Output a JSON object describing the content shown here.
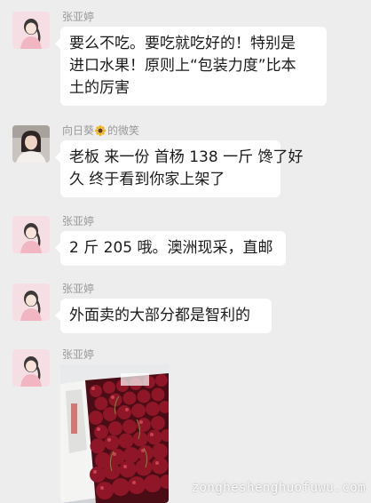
{
  "messages": [
    {
      "sender": "张亚婷",
      "avatar_icon": "girl-avatar-icon",
      "lines": [
        "要么不吃。要吃就吃好的！特别是",
        "进口水果！原则上“包装力度”比本",
        "土的厉害"
      ]
    },
    {
      "sender_prefix": "向日葵",
      "sender_emoji": "sunflower-icon",
      "sender_suffix": "的微笑",
      "avatar_icon": "woman-photo-avatar-icon",
      "lines": [
        "老板 来一份 首杨 138 一斤 馋了好",
        "久 终于看到你家上架了"
      ]
    },
    {
      "sender": "张亚婷",
      "avatar_icon": "girl-avatar-icon",
      "lines": [
        "2 斤 205 哦。澳洲现采，直邮"
      ]
    },
    {
      "sender": "张亚婷",
      "avatar_icon": "girl-avatar-icon",
      "lines": [
        "外面卖的大部分都是智利的"
      ]
    },
    {
      "sender": "张亚婷",
      "avatar_icon": "girl-avatar-icon",
      "image": "cherry-box-photo"
    }
  ],
  "watermark": "zongheshenghuofuwu.com",
  "colors": {
    "background": "#ededed",
    "bubble": "#ffffff",
    "sender_name": "#999999",
    "text": "#1a1a1a"
  }
}
